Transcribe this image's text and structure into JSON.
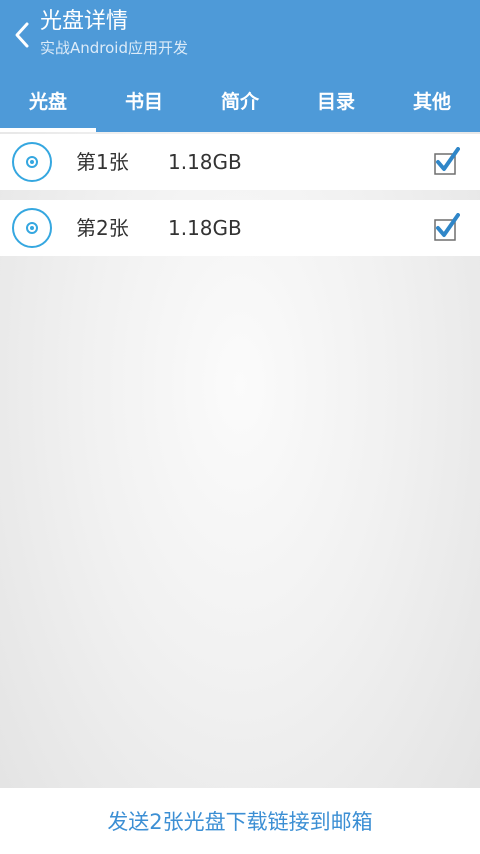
{
  "header": {
    "title": "光盘详情",
    "subtitle": "实战Android应用开发",
    "back_icon": "chevron-left-icon"
  },
  "tabs": [
    {
      "label": "光盘",
      "active": true
    },
    {
      "label": "书目",
      "active": false
    },
    {
      "label": "简介",
      "active": false
    },
    {
      "label": "目录",
      "active": false
    },
    {
      "label": "其他",
      "active": false
    }
  ],
  "discs": [
    {
      "label": "第1张",
      "size": "1.18GB",
      "checked": true,
      "icon": "disc-icon"
    },
    {
      "label": "第2张",
      "size": "1.18GB",
      "checked": true,
      "icon": "disc-icon"
    }
  ],
  "footer": {
    "send_label": "发送2张光盘下载链接到邮箱"
  },
  "colors": {
    "primary": "#4e9ad8",
    "accent": "#3c8fd4",
    "disc_ring": "#35a7e0",
    "check": "#2f86c8"
  }
}
